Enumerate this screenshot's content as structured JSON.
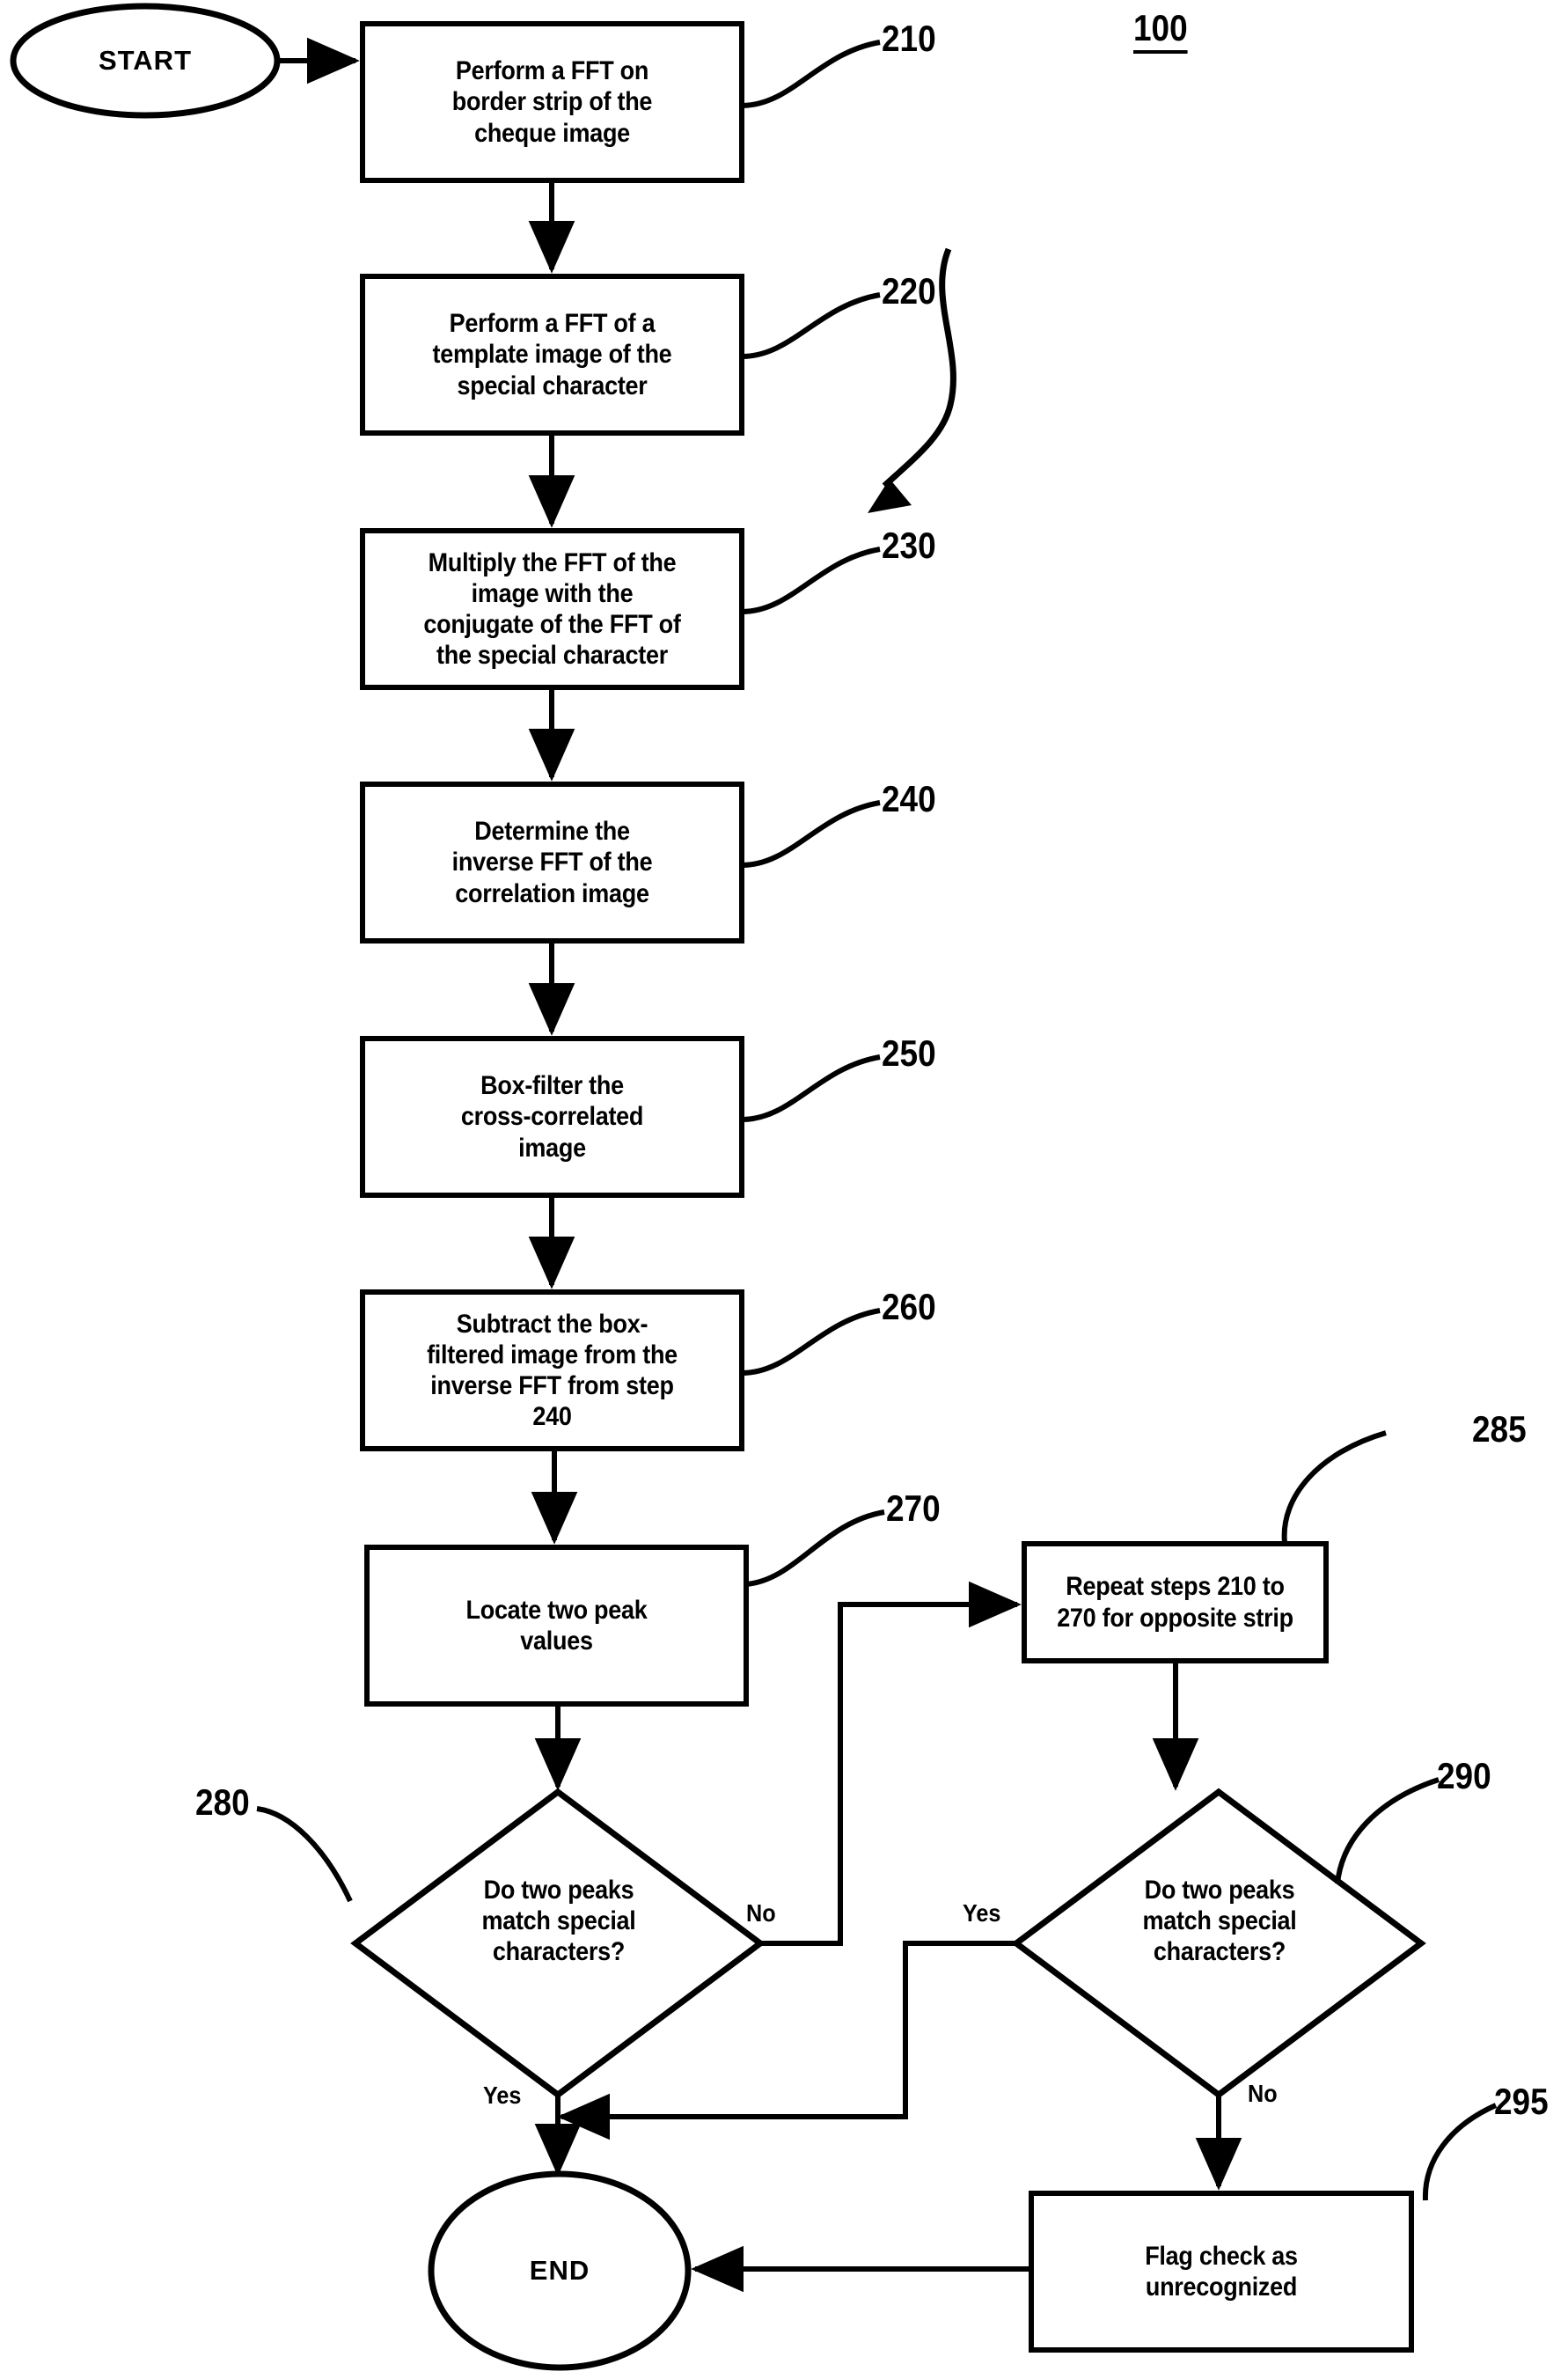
{
  "figure": {
    "title_ref": "100",
    "terminators": [
      {
        "id": "start",
        "label": "START"
      },
      {
        "id": "end",
        "label": "END"
      }
    ],
    "process_steps": [
      {
        "ref": "210",
        "label": "Perform a FFT on border strip of the cheque image"
      },
      {
        "ref": "220",
        "label": "Perform a FFT of a template image of the special character"
      },
      {
        "ref": "230",
        "label": "Multiply the FFT of the image with the conjugate of the FFT of the special character"
      },
      {
        "ref": "240",
        "label": "Determine the inverse FFT of the correlation image"
      },
      {
        "ref": "250",
        "label": "Box-filter the cross-correlated image"
      },
      {
        "ref": "260",
        "label": "Subtract the box-filtered image from the inverse FFT from step 240"
      },
      {
        "ref": "270",
        "label": "Locate two peak values"
      },
      {
        "ref": "285",
        "label": "Repeat steps 210 to 270 for opposite strip"
      },
      {
        "ref": "295",
        "label": "Flag check as unrecognized"
      }
    ],
    "decisions": [
      {
        "ref": "280",
        "label": "Do two peaks match special characters?",
        "branch_no": "No",
        "branch_yes": "Yes"
      },
      {
        "ref": "290",
        "label": "Do two peaks match special characters?",
        "branch_yes": "Yes",
        "branch_no": "No"
      }
    ],
    "line_text": {
      "step_210_l1": "Perform a FFT on",
      "step_210_l2": "border strip of the",
      "step_210_l3": "cheque image",
      "step_220_l1": "Perform a FFT of a",
      "step_220_l2": "template image of the",
      "step_220_l3": "special character",
      "step_230_l1": "Multiply the FFT of the",
      "step_230_l2": "image with the",
      "step_230_l3": "conjugate of the FFT of",
      "step_230_l4": "the special character",
      "step_240_l1": "Determine the",
      "step_240_l2": "inverse FFT of the",
      "step_240_l3": "correlation image",
      "step_250_l1": "Box-filter the",
      "step_250_l2": "cross-correlated",
      "step_250_l3": "image",
      "step_260_l1": "Subtract the box-",
      "step_260_l2": "filtered image from the",
      "step_260_l3": "inverse FFT from step",
      "step_260_l4": "240",
      "step_270_l1": "Locate two peak",
      "step_270_l2": "values",
      "step_285_l1": "Repeat steps 210 to",
      "step_285_l2": "270 for opposite strip",
      "step_295_l1": "Flag check as",
      "step_295_l2": "unrecognized",
      "dec_l1": "Do two peaks",
      "dec_l2": "match special",
      "dec_l3": "characters?"
    },
    "colors": {
      "ink": "#000000",
      "paper": "#ffffff"
    }
  }
}
